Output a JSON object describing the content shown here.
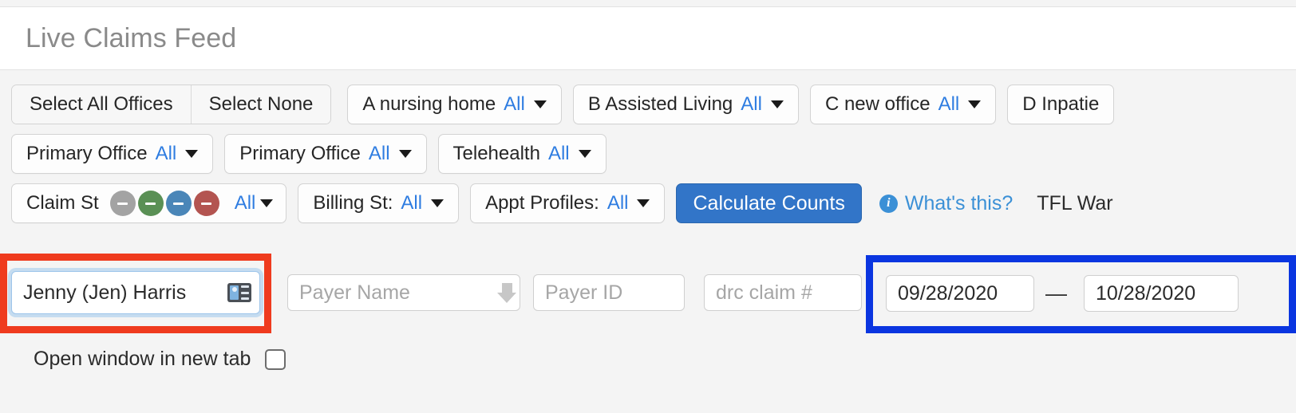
{
  "header": {
    "title": "Live Claims Feed"
  },
  "office_actions": {
    "select_all": "Select All Offices",
    "select_none": "Select None"
  },
  "office_filters": [
    {
      "label": "A nursing home",
      "value": "All",
      "icon": "chevron-down-icon"
    },
    {
      "label": "B Assisted Living",
      "value": "All",
      "icon": "chevron-down-icon"
    },
    {
      "label": "C new office",
      "value": "All",
      "icon": "chevron-down-icon"
    },
    {
      "label": "D Inpatie",
      "value": "",
      "icon": "chevron-down-icon"
    }
  ],
  "location_filters": [
    {
      "label": "Primary Office",
      "value": "All",
      "icon": "chevron-down-icon"
    },
    {
      "label": "Primary Office",
      "value": "All",
      "icon": "chevron-down-icon"
    },
    {
      "label": "Telehealth",
      "value": "All",
      "icon": "chevron-down-icon"
    }
  ],
  "status_row": {
    "claim_status": {
      "label": "Claim St",
      "value": "All",
      "dots": [
        {
          "name": "status-dot-gray",
          "color": "#a3a3a3",
          "glyph": "-"
        },
        {
          "name": "status-dot-green",
          "color": "#5a9055",
          "glyph": "-"
        },
        {
          "name": "status-dot-blue",
          "color": "#4a86b8",
          "glyph": "-"
        },
        {
          "name": "status-dot-red",
          "color": "#b35450",
          "glyph": "-"
        }
      ]
    },
    "billing_status": {
      "label": "Billing St:",
      "value": "All"
    },
    "appt_profiles": {
      "label": "Appt Profiles:",
      "value": "All"
    },
    "calculate_button": "Calculate Counts",
    "whats_this": "What's this?",
    "tfl_label": "TFL War"
  },
  "search_row": {
    "provider_name": {
      "value": "Jenny (Jen) Harris",
      "icon": "contact-card-icon",
      "highlight_color": "#ef3b1e"
    },
    "payer_name": {
      "placeholder": "Payer Name",
      "icon": "download-arrow-icon"
    },
    "payer_id": {
      "placeholder": "Payer ID"
    },
    "drc_claim": {
      "placeholder": "drc claim #"
    },
    "date_range": {
      "from": "09/28/2020",
      "separator": "—",
      "to": "10/28/2020",
      "highlight_color": "#0a35e0"
    }
  },
  "footer": {
    "open_new_tab_label": "Open window in new tab",
    "open_new_tab_checked": false
  },
  "colors": {
    "accent_blue": "#2f7de1",
    "primary_button": "#3275c8",
    "link_blue": "#3b90d6",
    "page_bg": "#f4f4f4"
  }
}
